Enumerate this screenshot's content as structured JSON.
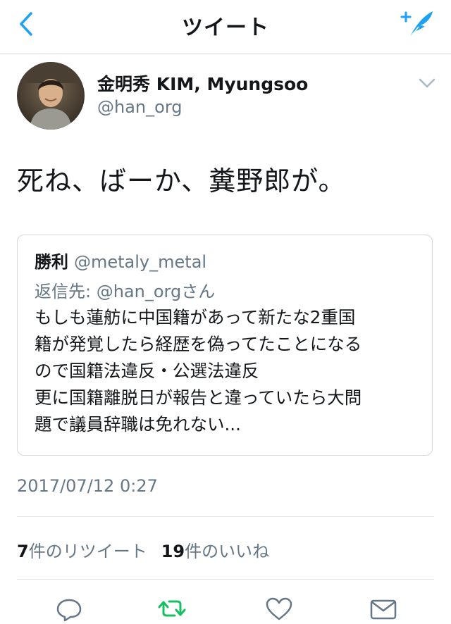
{
  "nav": {
    "title": "ツイート",
    "back_icon": "chevron-left-icon",
    "compose_icon": "compose-tweet-icon"
  },
  "tweet": {
    "author_name": "金明秀 KIM, Myungsoo",
    "author_handle": "@han_org",
    "text": "死ね、ばーか、糞野郎が。",
    "timestamp": "2017/07/12 0:27",
    "retweet_count": "7",
    "retweet_label": "件のリツイート",
    "like_count": "19",
    "like_label": "件のいいね"
  },
  "quoted": {
    "name": "勝利",
    "handle": "@metaly_metal",
    "reply_to": "返信先: @han_orgさん",
    "lines": [
      "もしも蓮舫に中国籍があって新たな2重国",
      "籍が発覚したら経歴を偽ってたことになる",
      "ので国籍法違反・公選法違反",
      "更に国籍離脱日が報告と違っていたら大問",
      "題で議員辞職は免れない..."
    ]
  },
  "actions": [
    "reply-icon",
    "retweet-icon",
    "like-icon",
    "direct-message-icon"
  ],
  "colors": {
    "accent": "#1da1f2",
    "retweet_green": "#17bf63",
    "muted": "#657786",
    "text": "#14171a",
    "border": "#d1d8de"
  }
}
